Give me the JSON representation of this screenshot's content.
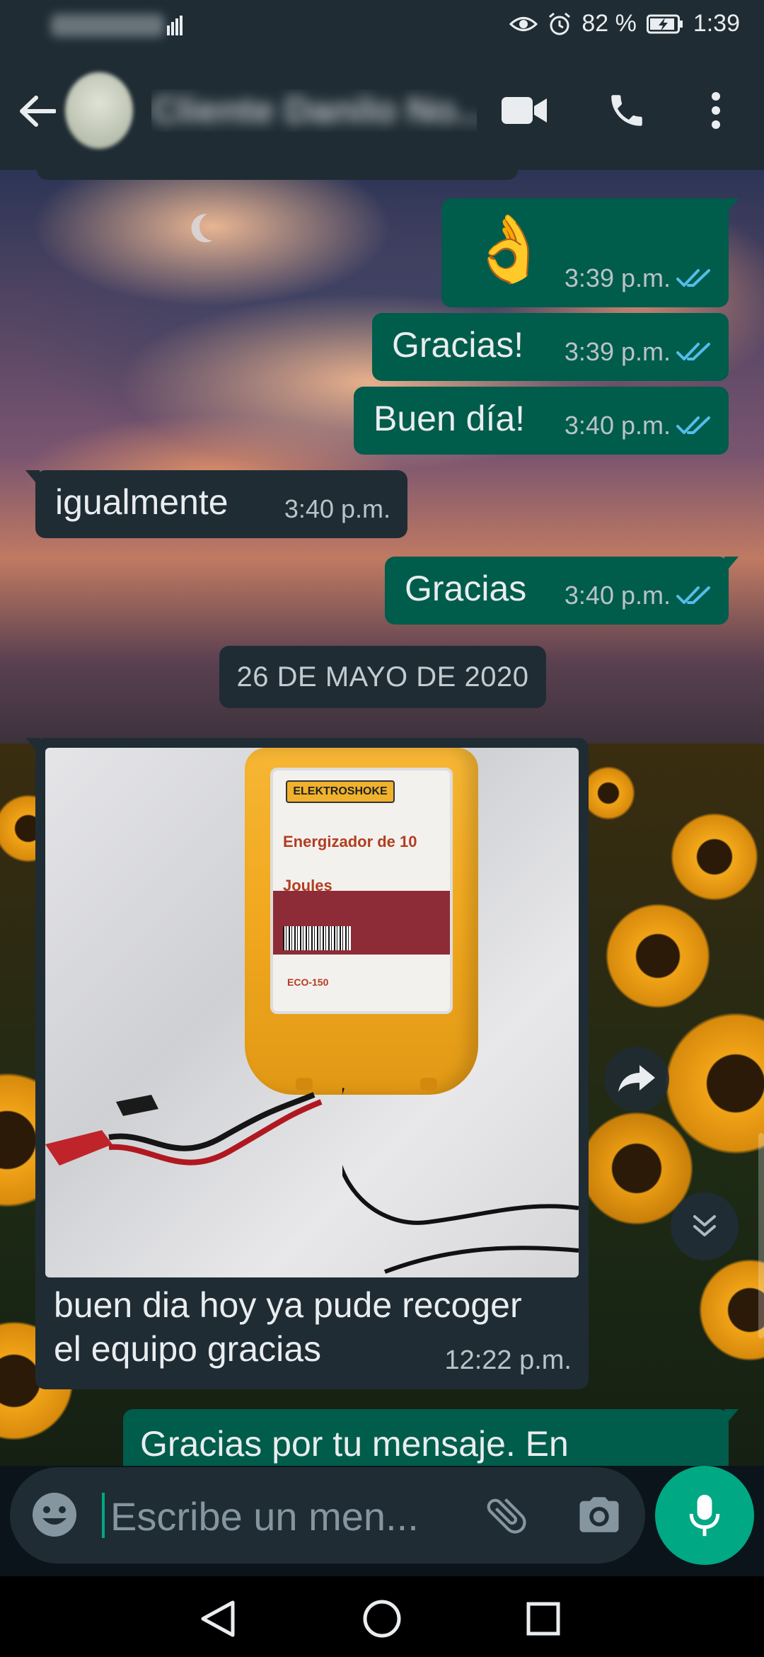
{
  "status_bar": {
    "battery_percent": "82 %",
    "time": "1:39"
  },
  "header": {
    "contact_name": "Cliente Danilo No..."
  },
  "messages": [
    {
      "direction": "out",
      "text": "👌",
      "time": "3:39 p.m.",
      "status": "read"
    },
    {
      "direction": "out",
      "text": "Gracias!",
      "time": "3:39 p.m.",
      "status": "read"
    },
    {
      "direction": "out",
      "text": "Buen día!",
      "time": "3:40 p.m.",
      "status": "read"
    },
    {
      "direction": "in",
      "text": "igualmente",
      "time": "3:40 p.m."
    },
    {
      "direction": "out",
      "text": "Gracias",
      "time": "3:40 p.m.",
      "status": "read"
    }
  ],
  "date_separator": "26 DE MAYO DE 2020",
  "image_message": {
    "product_brand": "ELEKTROSHOKE",
    "product_title": "Energizador de 10 Joules",
    "product_model": "ECO-150",
    "caption_line1": "buen dia hoy ya pude recoger",
    "caption_line2": "el equipo gracias",
    "time": "12:22 p.m."
  },
  "partial_message": {
    "text": "Gracias por tu mensaje. En"
  },
  "composer": {
    "placeholder": "Escribe un men..."
  },
  "colors": {
    "outgoing_bubble": "#005c4b",
    "incoming_bubble": "#1f2c34",
    "accent": "#00a884",
    "read_ticks": "#53bdeb"
  }
}
